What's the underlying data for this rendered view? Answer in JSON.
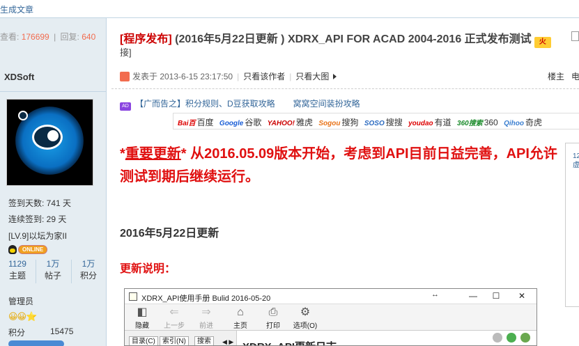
{
  "topbar": {
    "back_label": "生成文章"
  },
  "stats": {
    "view_label": "查看:",
    "views": "176699",
    "sep": "|",
    "reply_label": "回复:",
    "replies": "640"
  },
  "thread": {
    "tag": "[程序发布]",
    "title": " (2016年5月22日更新 ) XDRX_API FOR ACAD 2004-2016 正式发布测试",
    "badge": "火",
    "title_cont": "接]"
  },
  "author": {
    "name": "XDSoft",
    "signin_days": "签到天数: 741 天",
    "streak": "连续签到: 29 天",
    "level": "[LV.9]以坛为家II",
    "online": "ONLINE",
    "counts": [
      {
        "value": "1129",
        "label": "主题"
      },
      {
        "value": "1万",
        "label": "帖子"
      },
      {
        "value": "1万",
        "label": "积分"
      }
    ],
    "role": "管理员",
    "medals": "😀😀⭐",
    "points_label": "积分",
    "points": "15475"
  },
  "post": {
    "posted_at": "发表于 2013-6-15 23:17:50",
    "only_author": "只看该作者",
    "big_image": "只看大图",
    "floor": "楼主",
    "floor_extra": "电"
  },
  "ads": [
    "【广而告之】积分规则、D豆获取攻略",
    "窝窝空间装扮攻略"
  ],
  "ad_badge": "AD",
  "search_engines": [
    {
      "logo": "Bai百",
      "name": "百度"
    },
    {
      "logo": "Google",
      "name": "谷歌"
    },
    {
      "logo": "YAHOO!",
      "name": "雅虎"
    },
    {
      "logo": "Sogou",
      "name": "搜狗"
    },
    {
      "logo": "SOSO",
      "name": "搜搜"
    },
    {
      "logo": "youdao",
      "name": "有道"
    },
    {
      "logo": "360搜索",
      "name": "360"
    },
    {
      "logo": "Qihoo",
      "name": "奇虎"
    }
  ],
  "content": {
    "announce_star1": "*",
    "announce_ul": "重要更新",
    "announce_star2": "*",
    "announce_rest": " 从2016.05.09版本开始，考虑到API目前日益完善，API允许测试到期后继续运行。",
    "heading": "2016年5月22日更新",
    "notes_heading": "更新说明："
  },
  "rightbox": {
    "line1": "12",
    "line2": "虚"
  },
  "screenshot": {
    "window_title": "XDRX_API使用手册 Bulid 2016-05-20",
    "resize_glyph": "↔",
    "win_min": "—",
    "win_max": "☐",
    "win_close": "✕",
    "tools": [
      {
        "glyph": "◧",
        "label": "隐藏",
        "disabled": false
      },
      {
        "glyph": "⇐",
        "label": "上一步",
        "disabled": true
      },
      {
        "glyph": "⇒",
        "label": "前进",
        "disabled": true
      },
      {
        "glyph": "⌂",
        "label": "主页",
        "disabled": false
      },
      {
        "glyph": "⎙",
        "label": "打印",
        "disabled": false
      },
      {
        "glyph": "⚙",
        "label": "选项(O)",
        "disabled": false
      }
    ],
    "tabs": [
      "目录(C)",
      "索引(N)",
      "搜索"
    ],
    "tab_arrows": "◀ ▶",
    "doc_title": "XDRX_API更新日志"
  },
  "colors": {
    "accent_red": "#e01010",
    "link_blue": "#336699",
    "sidebar_bg": "#e5edf2"
  }
}
